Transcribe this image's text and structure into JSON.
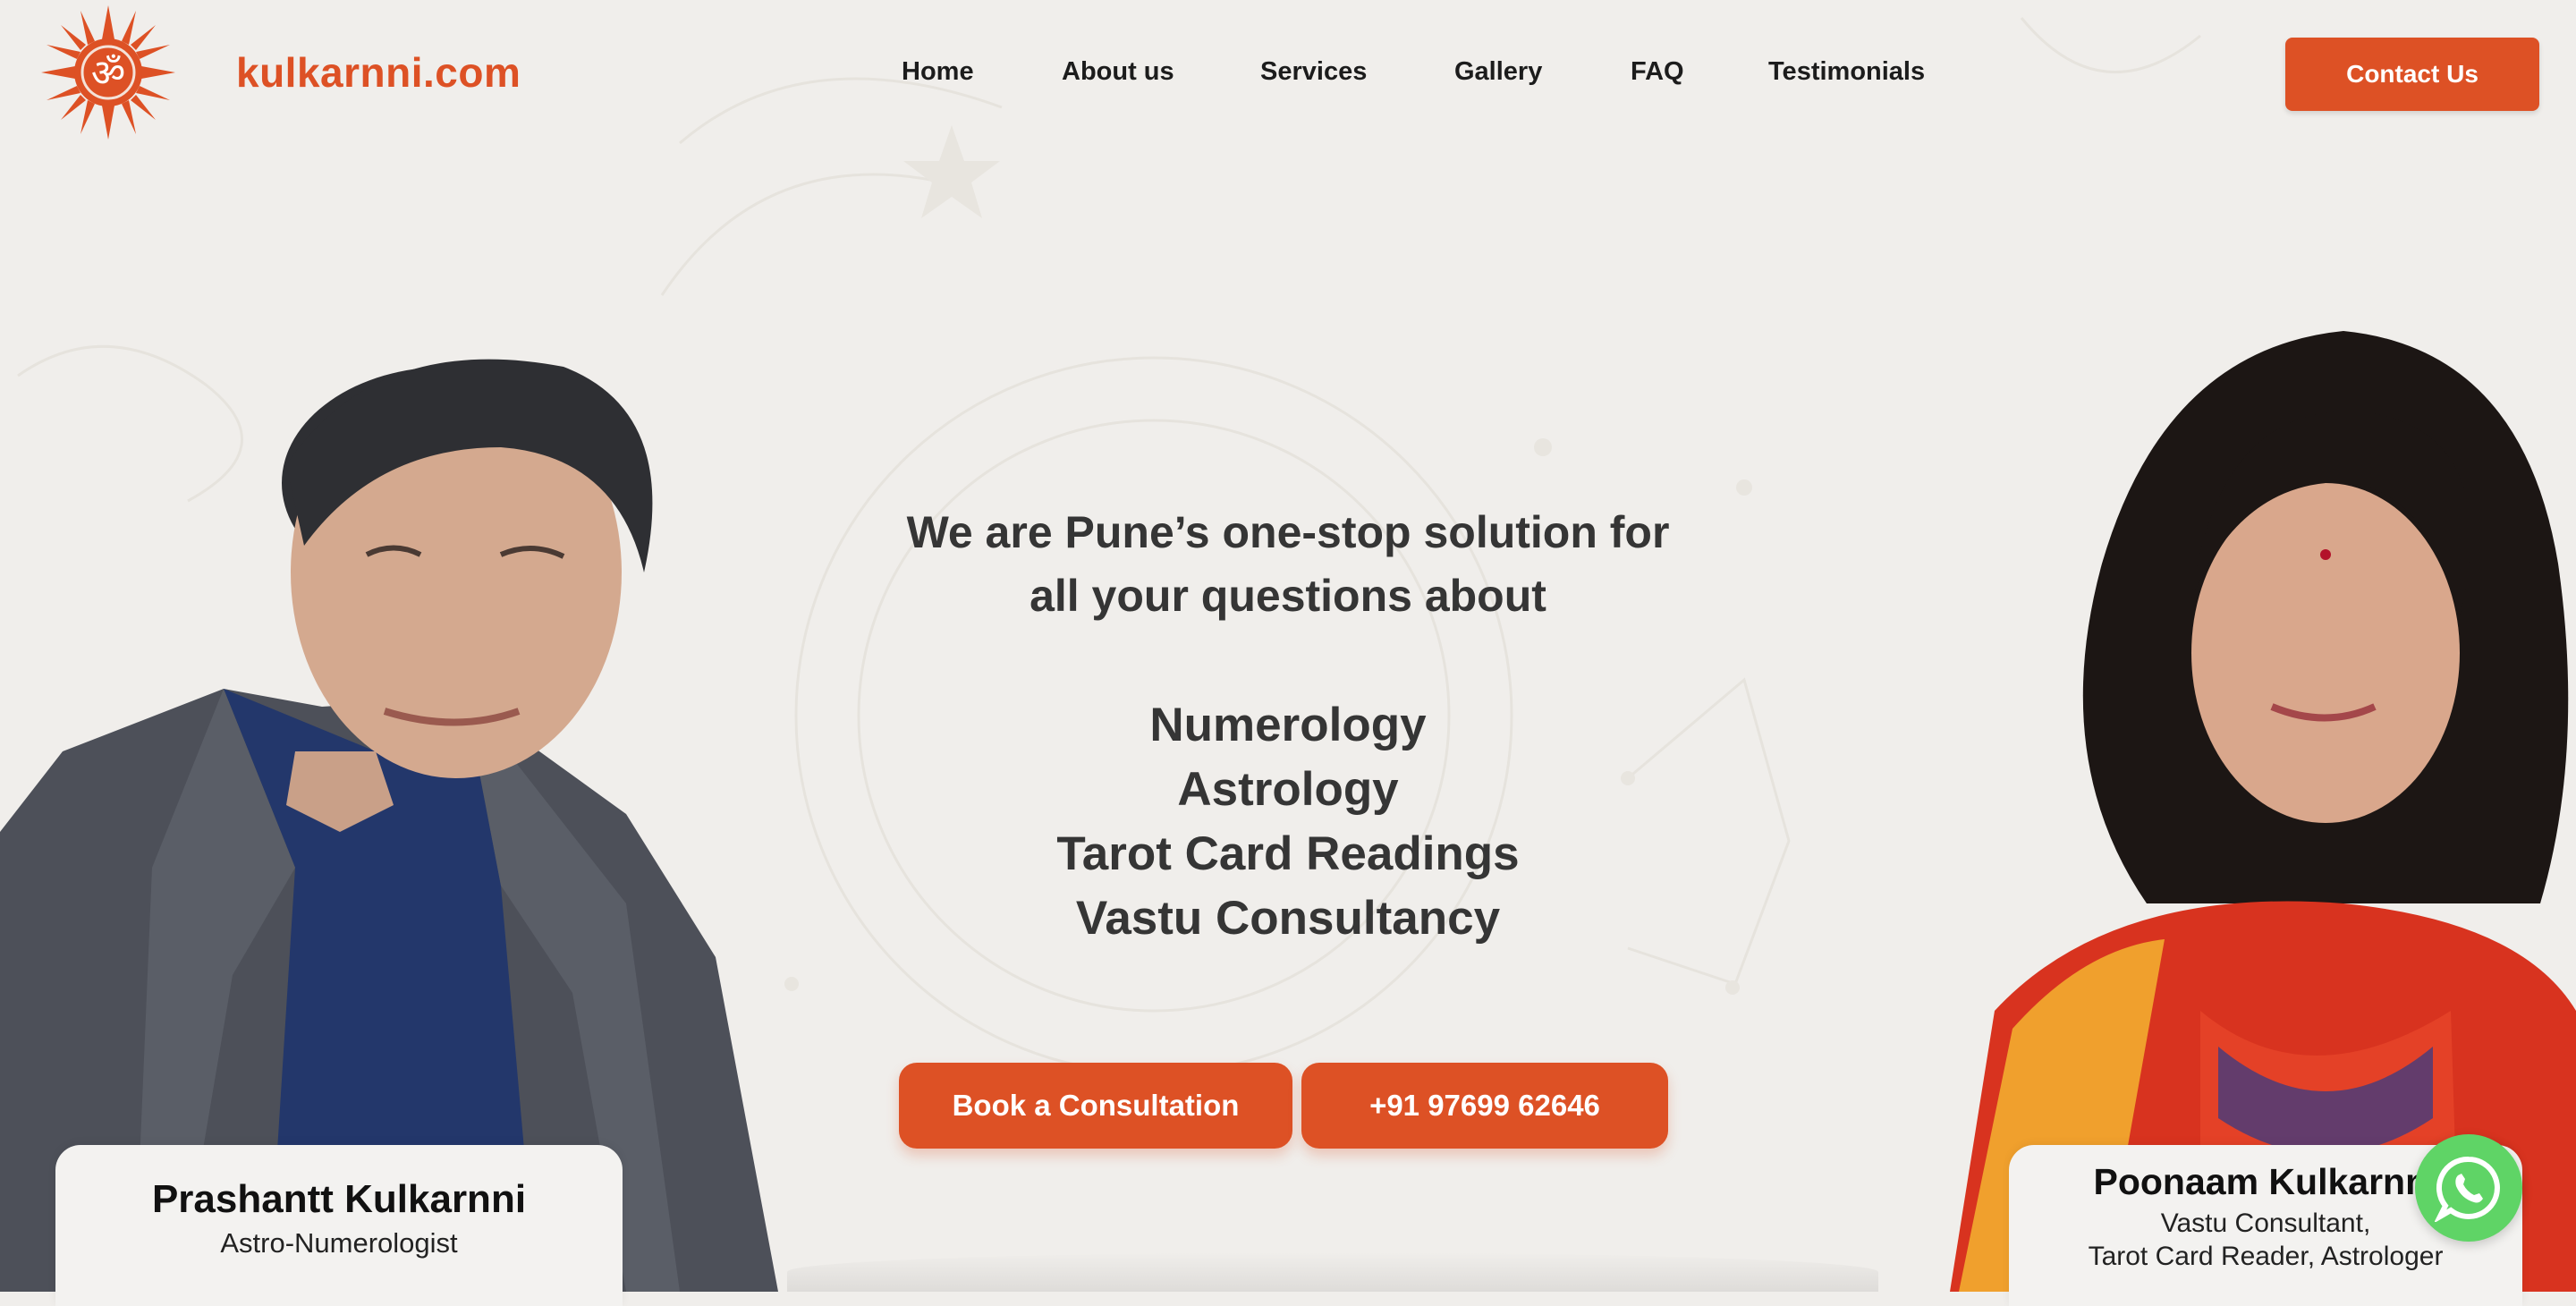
{
  "brand": {
    "name": "kulkarnni.com",
    "logo_icon": "om-sun-icon",
    "accent_color": "#dd5125"
  },
  "nav": {
    "items": [
      {
        "label": "Home"
      },
      {
        "label": "About us"
      },
      {
        "label": "Services"
      },
      {
        "label": "Gallery"
      },
      {
        "label": "FAQ"
      },
      {
        "label": "Testimonials"
      }
    ],
    "contact_label": "Contact Us"
  },
  "hero": {
    "intro_line1": "We are Pune’s one-stop solution for",
    "intro_line2": "all your questions about",
    "services": [
      "Numerology",
      "Astrology",
      "Tarot Card Readings",
      "Vastu Consultancy"
    ],
    "book_label": "Book a Consultation",
    "phone_label": "+91 97699 62646"
  },
  "people": {
    "left": {
      "name": "Prashantt Kulkarnni",
      "role": "Astro-Numerologist"
    },
    "right": {
      "name": "Poonaam Kulkarnni",
      "role_line1": "Vastu Consultant,",
      "role_line2": "Tarot Card Reader, Astrologer"
    }
  },
  "whatsapp_icon": "whatsapp-icon"
}
